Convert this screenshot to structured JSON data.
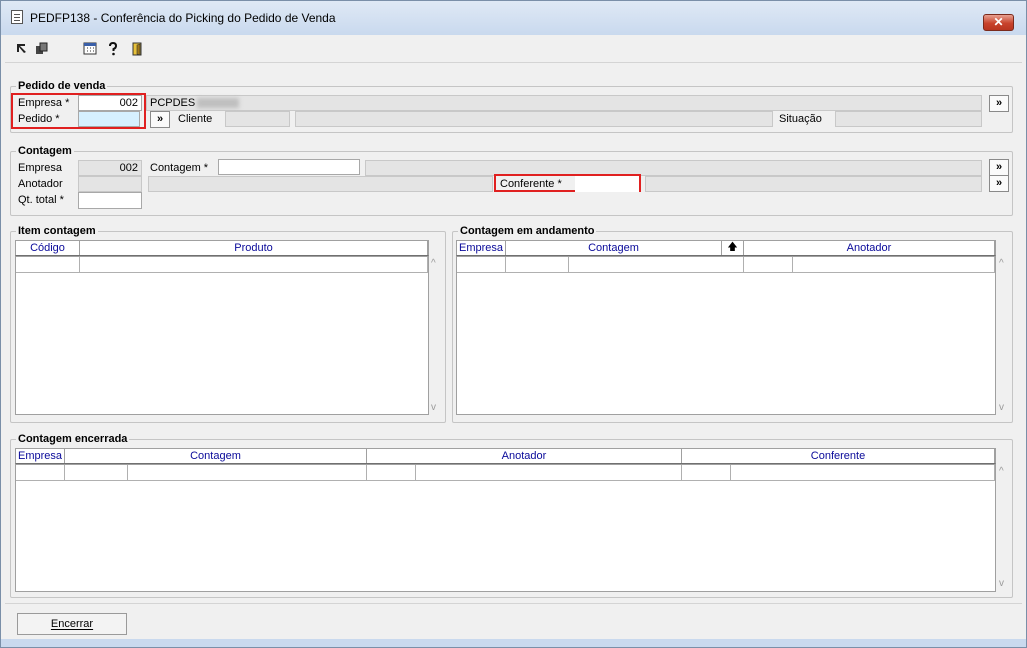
{
  "window": {
    "title": "PEDFP138 - Conferência do Picking do Pedido de Venda",
    "close_glyph": "✕"
  },
  "toolbar": {
    "icons": [
      "arrow-icon",
      "copy-icon",
      "calendar-icon",
      "help-icon",
      "exit-icon"
    ]
  },
  "pedido_venda": {
    "title": "Pedido de venda",
    "empresa_label": "Empresa *",
    "empresa_value": "002",
    "empresa_name": "PCPDES",
    "pedido_label": "Pedido *",
    "pedido_value": "",
    "cliente_label": "Cliente",
    "situacao_label": "Situação",
    "lookup_glyph": "»"
  },
  "contagem": {
    "title": "Contagem",
    "empresa_label": "Empresa",
    "empresa_value": "002",
    "contagem_label": "Contagem *",
    "anotador_label": "Anotador",
    "conferente_label": "Conferente *",
    "qt_total_label": "Qt. total *",
    "lookup_glyph": "»"
  },
  "item_contagem": {
    "title": "Item contagem",
    "columns": [
      "Código",
      "Produto"
    ]
  },
  "contagem_andamento": {
    "title": "Contagem em andamento",
    "columns": [
      "Empresa",
      "Contagem",
      "Anotador"
    ],
    "sort_glyph": "🡅"
  },
  "contagem_encerrada": {
    "title": "Contagem encerrada",
    "columns": [
      "Empresa",
      "Contagem",
      "Anotador",
      "Conferente"
    ]
  },
  "actions": {
    "encerrar_label": "Encerrar"
  },
  "scroll": {
    "up": "^",
    "down": "v"
  }
}
